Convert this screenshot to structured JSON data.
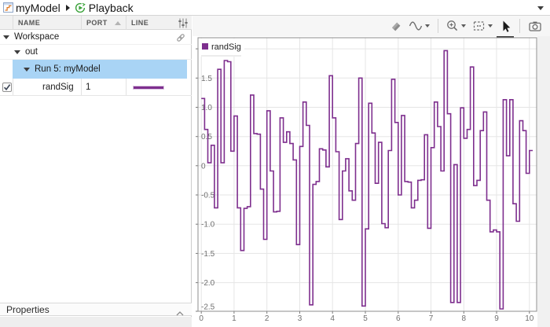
{
  "breadcrumb": {
    "model_label": "myModel",
    "view_label": "Playback"
  },
  "signal_table": {
    "columns": [
      "NAME",
      "PORT",
      "LINE"
    ],
    "rows": [
      {
        "label": "Workspace",
        "type": "group",
        "expanded": true,
        "has_link_icon": true
      },
      {
        "label": "out",
        "type": "group",
        "expanded": true
      },
      {
        "label": "Run 5: myModel",
        "type": "run",
        "expanded": true,
        "selected": true
      },
      {
        "name": "randSig",
        "port": "1",
        "checked": true,
        "line_color": "#7E2F8E",
        "type": "signal"
      }
    ]
  },
  "properties": {
    "label": "Properties"
  },
  "toolbar": {
    "icons": [
      "eraser",
      "signal-wave",
      "zoom-in",
      "fit-to-view",
      "arrow-cursor",
      "camera"
    ],
    "active_tool": "arrow-cursor"
  },
  "colors": {
    "selection": "#a9d4f5",
    "signal": "#7E2F8E"
  },
  "chart_data": {
    "type": "stairs",
    "title": "",
    "xlabel": "",
    "ylabel": "",
    "xlim": [
      -0.1,
      10.22
    ],
    "ylim": [
      -2.49,
      2.19
    ],
    "x_ticks": [
      0,
      1,
      2,
      3,
      4,
      5,
      6,
      7,
      8,
      9,
      10
    ],
    "y_ticks": [
      2.0,
      1.5,
      1.0,
      0.5,
      0,
      -0.5,
      -1.0,
      -1.5,
      -2.0,
      -2.5
    ],
    "y_tick_labels": [
      "",
      "1.5",
      "1.0",
      "0.5",
      "0",
      "-0.5",
      "-1.0",
      "-1.5",
      "-2.0",
      "-2.5"
    ],
    "grid": true,
    "legend": {
      "label": "randSig",
      "position": "top-left"
    },
    "series": [
      {
        "name": "randSig",
        "color": "#7E2F8E",
        "t0": 0,
        "dt": 0.1,
        "t_end": 10.1,
        "values": [
          1.15,
          0.62,
          0.05,
          0.35,
          -0.72,
          1.65,
          0.05,
          1.8,
          1.78,
          0.25,
          0.85,
          -0.72,
          -1.45,
          -0.73,
          -0.7,
          1.21,
          0.55,
          0.54,
          -0.4,
          -1.26,
          0.94,
          -0.09,
          -0.79,
          -0.78,
          0.82,
          0.4,
          0.58,
          0.38,
          0.1,
          -1.35,
          0.33,
          1.09,
          0.69,
          -2.38,
          -0.32,
          -0.27,
          0.29,
          0.27,
          -0.02,
          1.54,
          0.82,
          0.24,
          -0.92,
          -0.09,
          0.12,
          -0.43,
          -0.59,
          0.38,
          1.5,
          -2.4,
          -1.08,
          1.07,
          0.56,
          -0.3,
          0.4,
          -0.99,
          -1.06,
          0.26,
          1.48,
          0.74,
          -0.5,
          0.86,
          -0.27,
          -0.28,
          -0.72,
          -0.59,
          -0.25,
          -0.24,
          0.53,
          -1.07,
          0.31,
          1.09,
          0.67,
          -0.09,
          1.97,
          0.89,
          -2.34,
          0.02,
          -2.34,
          0.99,
          0.47,
          0.62,
          1.69,
          -0.34,
          -0.25,
          0.6,
          0.92,
          -0.59,
          -1.13,
          -1.1,
          -1.13,
          -2.45,
          1.13,
          0.17,
          1.13,
          -0.65,
          -0.95,
          0.77,
          0.6,
          -0.13,
          0.26
        ]
      }
    ]
  }
}
